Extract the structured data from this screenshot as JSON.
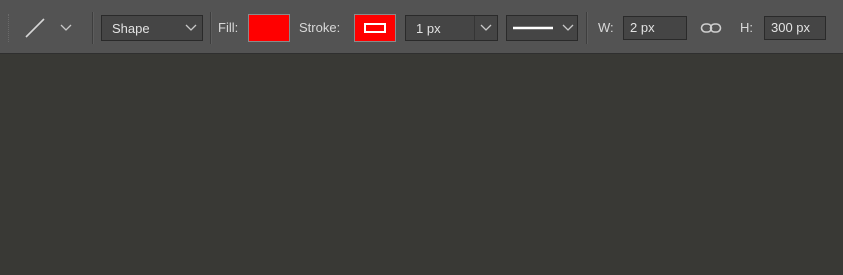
{
  "options_bar": {
    "tool_icon": "line-tool-icon",
    "mode_dropdown": {
      "value": "Shape",
      "icon": "chevron-down-icon"
    },
    "fill": {
      "label": "Fill:",
      "color": "#ff0000"
    },
    "stroke": {
      "label": "Stroke:",
      "color": "#ff0000",
      "inner_color": "#ffffff"
    },
    "stroke_width": {
      "value": "1 px"
    },
    "stroke_type": {
      "icon": "solid-line-icon"
    },
    "width": {
      "label": "W:",
      "value": "2 px"
    },
    "link_icon": "link-icon",
    "height": {
      "label": "H:",
      "value": "300 px"
    }
  },
  "colors": {
    "toolbar_bg": "#535353",
    "canvas_bg": "#393935",
    "field_bg": "#454545"
  }
}
